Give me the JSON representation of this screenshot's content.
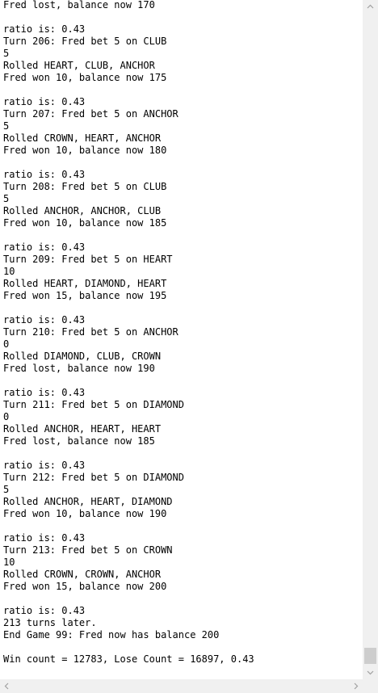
{
  "console": {
    "lines": [
      "Fred lost, balance now 170",
      "",
      "ratio is: 0.43",
      "Turn 206: Fred bet 5 on CLUB",
      "5",
      "Rolled HEART, CLUB, ANCHOR",
      "Fred won 10, balance now 175",
      "",
      "ratio is: 0.43",
      "Turn 207: Fred bet 5 on ANCHOR",
      "5",
      "Rolled CROWN, HEART, ANCHOR",
      "Fred won 10, balance now 180",
      "",
      "ratio is: 0.43",
      "Turn 208: Fred bet 5 on CLUB",
      "5",
      "Rolled ANCHOR, ANCHOR, CLUB",
      "Fred won 10, balance now 185",
      "",
      "ratio is: 0.43",
      "Turn 209: Fred bet 5 on HEART",
      "10",
      "Rolled HEART, DIAMOND, HEART",
      "Fred won 15, balance now 195",
      "",
      "ratio is: 0.43",
      "Turn 210: Fred bet 5 on ANCHOR",
      "0",
      "Rolled DIAMOND, CLUB, CROWN",
      "Fred lost, balance now 190",
      "",
      "ratio is: 0.43",
      "Turn 211: Fred bet 5 on DIAMOND",
      "0",
      "Rolled ANCHOR, HEART, HEART",
      "Fred lost, balance now 185",
      "",
      "ratio is: 0.43",
      "Turn 212: Fred bet 5 on DIAMOND",
      "5",
      "Rolled ANCHOR, HEART, DIAMOND",
      "Fred won 10, balance now 190",
      "",
      "ratio is: 0.43",
      "Turn 213: Fred bet 5 on CROWN",
      "10",
      "Rolled CROWN, CROWN, ANCHOR",
      "Fred won 15, balance now 200",
      "",
      "ratio is: 0.43",
      "213 turns later.",
      "End Game 99: Fred now has balance 200",
      "",
      "Win count = 12783, Lose Count = 16897, 0.43"
    ]
  },
  "scrollbars": {
    "vertical_scroll_position": 1.0,
    "icons": {
      "up": "chevron-up-icon",
      "down": "chevron-down-icon",
      "left": "chevron-left-icon",
      "right": "chevron-right-icon"
    },
    "colors": {
      "track": "#f0f0f0",
      "thumb": "#cdcdcd",
      "arrow": "#a0a0a0"
    }
  }
}
